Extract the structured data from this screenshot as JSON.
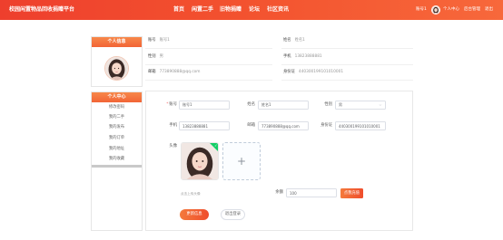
{
  "header": {
    "title": "校园闲置物品回收捐赠平台",
    "nav": [
      "首页",
      "闲置二手",
      "旧物捐赠",
      "论坛",
      "社区资讯"
    ],
    "username": "账号1",
    "links": [
      "个人中心",
      "后台管理",
      "退出"
    ]
  },
  "sidebar": {
    "profile_title": "个人信息",
    "center_title": "个人中心",
    "menu": [
      "修改密码",
      "我的二手",
      "我的发布",
      "我的订单",
      "我的地址",
      "我的收藏"
    ]
  },
  "profile": {
    "account_label": "账号",
    "account": "账号1",
    "name_label": "姓名",
    "name": "姓名1",
    "gender_label": "性别",
    "gender": "男",
    "phone_label": "手机",
    "phone": "13823888881",
    "email_label": "邮箱",
    "email": "773890888@qq.com",
    "idcard_label": "身份证",
    "idcard": "440300199101010001"
  },
  "form": {
    "required_mark": "*",
    "account_label": "账号",
    "account": "账号1",
    "name_label": "姓名",
    "name": "姓名1",
    "gender_label": "性别",
    "gender": "男",
    "phone_label": "手机",
    "phone": "13823888881",
    "email_label": "邮箱",
    "email": "773890888@qq.com",
    "idcard_label": "身份证",
    "idcard": "440300199101010001",
    "avatar_label": "头像",
    "upload_plus": "+",
    "upload_done": "✓",
    "upload_hint": "点击上传头像",
    "balance_label": "余额",
    "balance": "100",
    "recharge_button": "点我充值",
    "update_button": "更新信息",
    "logout_button": "退出登录"
  },
  "icons": {
    "header_avatar": "user-avatar-photo",
    "sidebar_avatar": "user-avatar-photo",
    "select_arrow": "chevron-down-icon",
    "upload_success": "check-icon",
    "upload_add": "plus-icon"
  },
  "colors": {
    "header_start": "#ee3f2d",
    "header_end": "#f7683b",
    "accent": "#f26436",
    "upload_success": "#13ce66",
    "required": "#f56c6c"
  }
}
